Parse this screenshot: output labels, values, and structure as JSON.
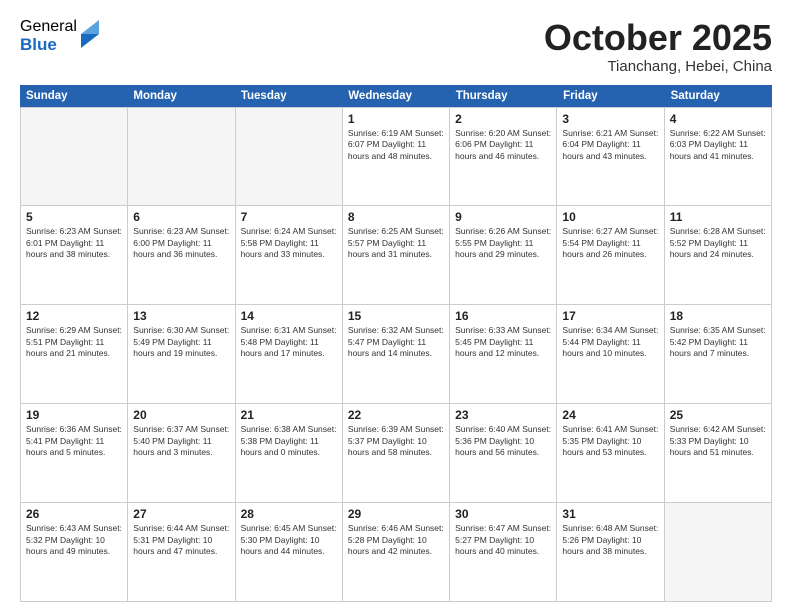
{
  "logo": {
    "general": "General",
    "blue": "Blue"
  },
  "title": "October 2025",
  "subtitle": "Tianchang, Hebei, China",
  "headers": [
    "Sunday",
    "Monday",
    "Tuesday",
    "Wednesday",
    "Thursday",
    "Friday",
    "Saturday"
  ],
  "weeks": [
    [
      {
        "day": "",
        "info": ""
      },
      {
        "day": "",
        "info": ""
      },
      {
        "day": "",
        "info": ""
      },
      {
        "day": "1",
        "info": "Sunrise: 6:19 AM\nSunset: 6:07 PM\nDaylight: 11 hours\nand 48 minutes."
      },
      {
        "day": "2",
        "info": "Sunrise: 6:20 AM\nSunset: 6:06 PM\nDaylight: 11 hours\nand 46 minutes."
      },
      {
        "day": "3",
        "info": "Sunrise: 6:21 AM\nSunset: 6:04 PM\nDaylight: 11 hours\nand 43 minutes."
      },
      {
        "day": "4",
        "info": "Sunrise: 6:22 AM\nSunset: 6:03 PM\nDaylight: 11 hours\nand 41 minutes."
      }
    ],
    [
      {
        "day": "5",
        "info": "Sunrise: 6:23 AM\nSunset: 6:01 PM\nDaylight: 11 hours\nand 38 minutes."
      },
      {
        "day": "6",
        "info": "Sunrise: 6:23 AM\nSunset: 6:00 PM\nDaylight: 11 hours\nand 36 minutes."
      },
      {
        "day": "7",
        "info": "Sunrise: 6:24 AM\nSunset: 5:58 PM\nDaylight: 11 hours\nand 33 minutes."
      },
      {
        "day": "8",
        "info": "Sunrise: 6:25 AM\nSunset: 5:57 PM\nDaylight: 11 hours\nand 31 minutes."
      },
      {
        "day": "9",
        "info": "Sunrise: 6:26 AM\nSunset: 5:55 PM\nDaylight: 11 hours\nand 29 minutes."
      },
      {
        "day": "10",
        "info": "Sunrise: 6:27 AM\nSunset: 5:54 PM\nDaylight: 11 hours\nand 26 minutes."
      },
      {
        "day": "11",
        "info": "Sunrise: 6:28 AM\nSunset: 5:52 PM\nDaylight: 11 hours\nand 24 minutes."
      }
    ],
    [
      {
        "day": "12",
        "info": "Sunrise: 6:29 AM\nSunset: 5:51 PM\nDaylight: 11 hours\nand 21 minutes."
      },
      {
        "day": "13",
        "info": "Sunrise: 6:30 AM\nSunset: 5:49 PM\nDaylight: 11 hours\nand 19 minutes."
      },
      {
        "day": "14",
        "info": "Sunrise: 6:31 AM\nSunset: 5:48 PM\nDaylight: 11 hours\nand 17 minutes."
      },
      {
        "day": "15",
        "info": "Sunrise: 6:32 AM\nSunset: 5:47 PM\nDaylight: 11 hours\nand 14 minutes."
      },
      {
        "day": "16",
        "info": "Sunrise: 6:33 AM\nSunset: 5:45 PM\nDaylight: 11 hours\nand 12 minutes."
      },
      {
        "day": "17",
        "info": "Sunrise: 6:34 AM\nSunset: 5:44 PM\nDaylight: 11 hours\nand 10 minutes."
      },
      {
        "day": "18",
        "info": "Sunrise: 6:35 AM\nSunset: 5:42 PM\nDaylight: 11 hours\nand 7 minutes."
      }
    ],
    [
      {
        "day": "19",
        "info": "Sunrise: 6:36 AM\nSunset: 5:41 PM\nDaylight: 11 hours\nand 5 minutes."
      },
      {
        "day": "20",
        "info": "Sunrise: 6:37 AM\nSunset: 5:40 PM\nDaylight: 11 hours\nand 3 minutes."
      },
      {
        "day": "21",
        "info": "Sunrise: 6:38 AM\nSunset: 5:38 PM\nDaylight: 11 hours\nand 0 minutes."
      },
      {
        "day": "22",
        "info": "Sunrise: 6:39 AM\nSunset: 5:37 PM\nDaylight: 10 hours\nand 58 minutes."
      },
      {
        "day": "23",
        "info": "Sunrise: 6:40 AM\nSunset: 5:36 PM\nDaylight: 10 hours\nand 56 minutes."
      },
      {
        "day": "24",
        "info": "Sunrise: 6:41 AM\nSunset: 5:35 PM\nDaylight: 10 hours\nand 53 minutes."
      },
      {
        "day": "25",
        "info": "Sunrise: 6:42 AM\nSunset: 5:33 PM\nDaylight: 10 hours\nand 51 minutes."
      }
    ],
    [
      {
        "day": "26",
        "info": "Sunrise: 6:43 AM\nSunset: 5:32 PM\nDaylight: 10 hours\nand 49 minutes."
      },
      {
        "day": "27",
        "info": "Sunrise: 6:44 AM\nSunset: 5:31 PM\nDaylight: 10 hours\nand 47 minutes."
      },
      {
        "day": "28",
        "info": "Sunrise: 6:45 AM\nSunset: 5:30 PM\nDaylight: 10 hours\nand 44 minutes."
      },
      {
        "day": "29",
        "info": "Sunrise: 6:46 AM\nSunset: 5:28 PM\nDaylight: 10 hours\nand 42 minutes."
      },
      {
        "day": "30",
        "info": "Sunrise: 6:47 AM\nSunset: 5:27 PM\nDaylight: 10 hours\nand 40 minutes."
      },
      {
        "day": "31",
        "info": "Sunrise: 6:48 AM\nSunset: 5:26 PM\nDaylight: 10 hours\nand 38 minutes."
      },
      {
        "day": "",
        "info": ""
      }
    ]
  ]
}
